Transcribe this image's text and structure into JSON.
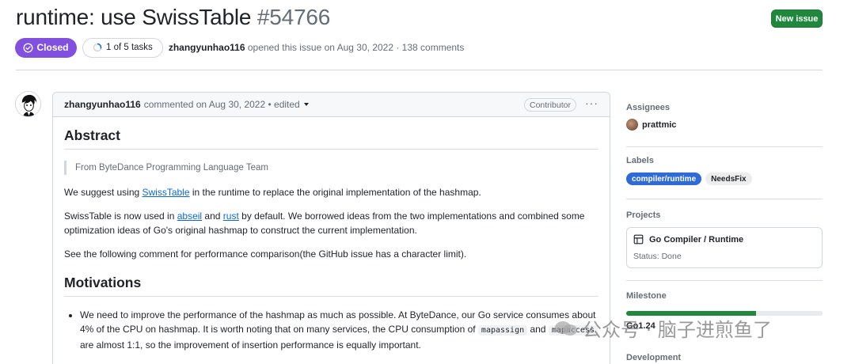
{
  "issue": {
    "title": "runtime: use SwissTable",
    "number": "#54766",
    "new_issue_label": "New issue",
    "state_label": "Closed",
    "tasks_label": "1 of 5 tasks",
    "author": "zhangyunhao116",
    "opened_text": "opened this issue on Aug 30, 2022 · 138 comments",
    "state_color": "#8250df"
  },
  "comment": {
    "author": "zhangyunhao116",
    "meta": "commented on Aug 30, 2022 • edited",
    "badge": "Contributor",
    "menu_icon": "kebab-horizontal-icon",
    "abstract_heading": "Abstract",
    "quote": "From ByteDance Programming Language Team",
    "p1_before": "We suggest using ",
    "p1_link": "SwissTable",
    "p1_after": " in the runtime to replace the original implementation of the hashmap.",
    "p2_a": "SwissTable is now used in ",
    "p2_link1": "abseil",
    "p2_b": " and ",
    "p2_link2": "rust",
    "p2_c": " by default. We borrowed ideas from the two implementations and combined some optimization ideas of Go's original hashmap to construct the current implementation.",
    "p3": "See the following comment for performance comparison(the GitHub issue has a character limit).",
    "motivations_heading": "Motivations",
    "li_a": "We need to improve the performance of the hashmap as much as possible. At ByteDance, our Go service consumes about 4% of the CPU on hashmap. It is worth noting that on many services, the CPU consumption of ",
    "li_code1": "mapassign",
    "li_b": " and ",
    "li_code2": "mapaccess",
    "li_c": " are almost 1:1, so the improvement of insertion performance is equally important."
  },
  "sidebar": {
    "assignees_heading": "Assignees",
    "assignee": "prattmic",
    "labels_heading": "Labels",
    "labels": [
      {
        "name": "compiler/runtime",
        "color": "#2f6bd8"
      },
      {
        "name": "NeedsFix",
        "color": "#ededed"
      }
    ],
    "projects_heading": "Projects",
    "project_name": "Go Compiler / Runtime",
    "project_icon": "table-icon",
    "project_status": "Status: Done",
    "milestone_heading": "Milestone",
    "milestone_progress_percent": 66,
    "milestone_name": "Go1.24",
    "development_heading": "Development"
  },
  "watermark": {
    "text": "公众号 · 脑子进煎鱼了",
    "icon": "wechat-icon"
  }
}
